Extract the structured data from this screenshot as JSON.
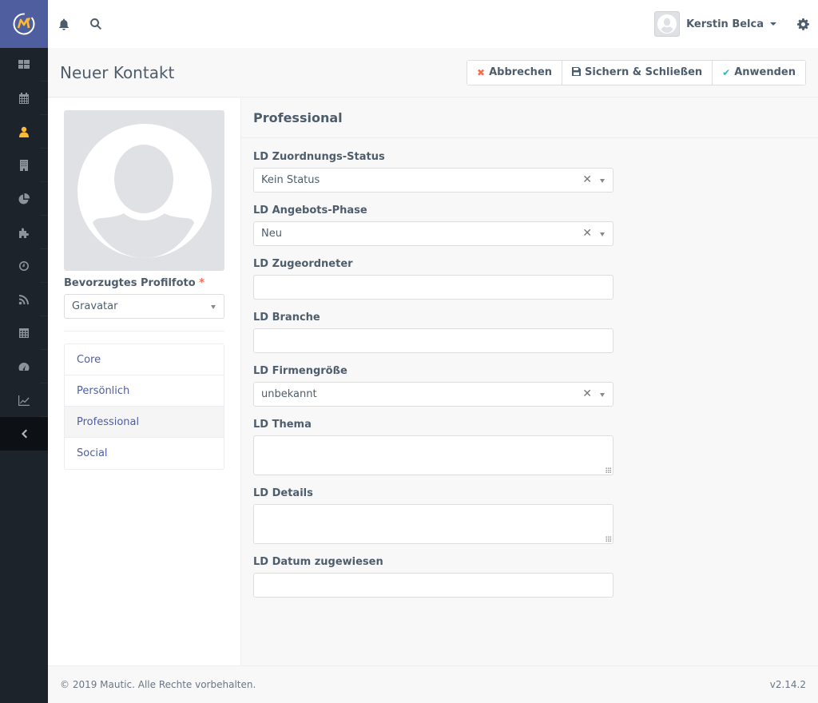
{
  "app": {
    "brand_color": "#4e5e9e",
    "accent_color": "#fdb933"
  },
  "sidebar": {
    "items": [
      {
        "icon": "dashboard-icon",
        "active": false
      },
      {
        "icon": "calendar-icon",
        "active": false
      },
      {
        "icon": "user-icon",
        "active": true
      },
      {
        "icon": "building-icon",
        "active": false
      },
      {
        "icon": "pie-chart-icon",
        "active": false
      },
      {
        "icon": "puzzle-icon",
        "active": false
      },
      {
        "icon": "clock-icon",
        "active": false
      },
      {
        "icon": "rss-icon",
        "active": false
      },
      {
        "icon": "calculator-icon",
        "active": false
      },
      {
        "icon": "tachometer-icon",
        "active": false
      },
      {
        "icon": "line-chart-icon",
        "active": false
      }
    ],
    "collapse_icon": "chevron-left-icon"
  },
  "topbar": {
    "user_name": "Kerstin Belca"
  },
  "header": {
    "title": "Neuer Kontakt",
    "buttons": {
      "cancel": "Abbrechen",
      "save_close": "Sichern & Schließen",
      "apply": "Anwenden"
    }
  },
  "left": {
    "profile_photo_label": "Bevorzugtes Profilfoto",
    "required_mark": "*",
    "profile_photo_value": "Gravatar",
    "tabs": [
      {
        "label": "Core",
        "active": false
      },
      {
        "label": "Persönlich",
        "active": false
      },
      {
        "label": "Professional",
        "active": true
      },
      {
        "label": "Social",
        "active": false
      }
    ]
  },
  "main": {
    "section_title": "Professional",
    "fields": {
      "zuordnungs_status": {
        "label": "LD Zuordnungs-Status",
        "value": "Kein Status"
      },
      "angebots_phase": {
        "label": "LD Angebots-Phase",
        "value": "Neu"
      },
      "zugeordneter": {
        "label": "LD Zugeordneter",
        "value": ""
      },
      "branche": {
        "label": "LD Branche",
        "value": ""
      },
      "firmengroesse": {
        "label": "LD Firmengröße",
        "value": "unbekannt"
      },
      "thema": {
        "label": "LD Thema",
        "value": ""
      },
      "details": {
        "label": "LD Details",
        "value": ""
      },
      "datum": {
        "label": "LD Datum zugewiesen",
        "value": ""
      }
    }
  },
  "footer": {
    "copyright": "© 2019 Mautic. Alle Rechte vorbehalten.",
    "version": "v2.14.2"
  }
}
